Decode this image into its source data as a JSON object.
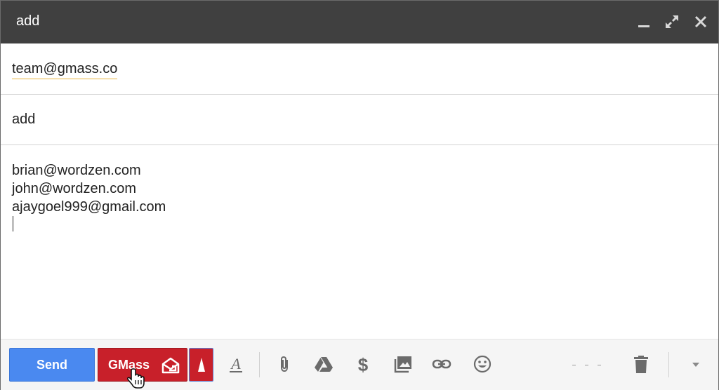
{
  "window": {
    "title": "add",
    "controls": [
      "minimize-icon",
      "expand-icon",
      "close-icon"
    ]
  },
  "compose": {
    "to_value": "team@gmass.co",
    "subject_value": "add",
    "body_lines": [
      "brian@wordzen.com",
      "john@wordzen.com",
      "ajaygoel999@gmail.com"
    ]
  },
  "toolbar": {
    "send_label": "Send",
    "gmass_label": "GMass",
    "colors": {
      "send": "#4a89f0",
      "gmass": "#c8202a",
      "titlebar": "#404040"
    },
    "icons": [
      "formatting-icon",
      "attach-icon",
      "drive-icon",
      "money-icon",
      "photo-icon",
      "link-icon",
      "emoji-icon",
      "trash-icon",
      "more-options-icon"
    ]
  }
}
